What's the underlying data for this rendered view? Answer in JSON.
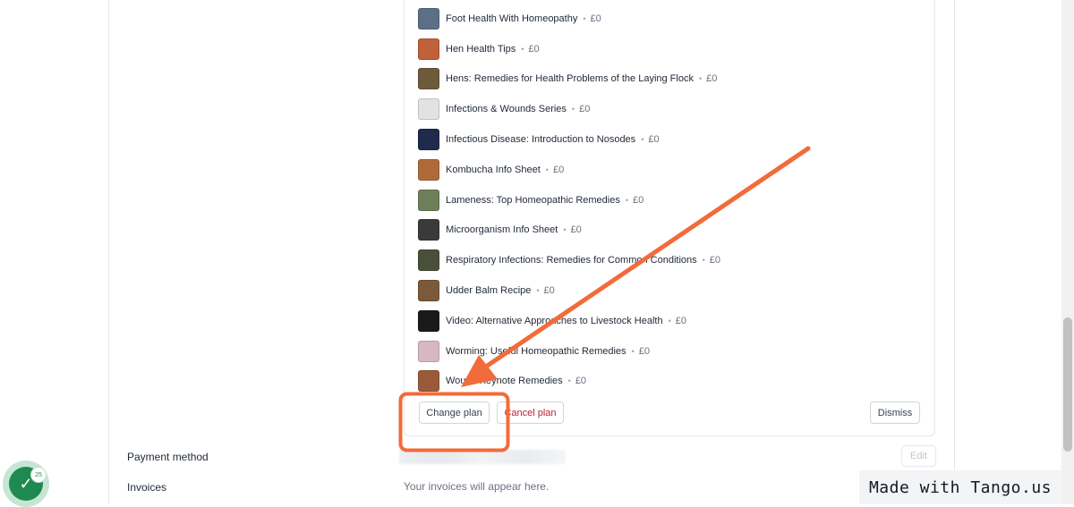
{
  "products": [
    {
      "name": "Foot Health With Homeopathy",
      "price": "£0",
      "thumb": "#5b6f86"
    },
    {
      "name": "Hen Health Tips",
      "price": "£0",
      "thumb": "#c0613a"
    },
    {
      "name": "Hens: Remedies for Health Problems of the Laying Flock",
      "price": "£0",
      "thumb": "#6d5a3a"
    },
    {
      "name": "Infections & Wounds Series",
      "price": "£0",
      "thumb": "#e2e2e2"
    },
    {
      "name": "Infectious Disease: Introduction to Nosodes",
      "price": "£0",
      "thumb": "#1f2a4d"
    },
    {
      "name": "Kombucha Info Sheet",
      "price": "£0",
      "thumb": "#b06a3a"
    },
    {
      "name": "Lameness: Top Homeopathic Remedies",
      "price": "£0",
      "thumb": "#6c7f59"
    },
    {
      "name": "Microorganism Info Sheet",
      "price": "£0",
      "thumb": "#3a3a3a"
    },
    {
      "name": "Respiratory Infections: Remedies for Common Conditions",
      "price": "£0",
      "thumb": "#4a4f3c"
    },
    {
      "name": "Udder Balm Recipe",
      "price": "£0",
      "thumb": "#7a5a3a"
    },
    {
      "name": "Video: Alternative Approaches to Livestock Health",
      "price": "£0",
      "thumb": "#1a1a1a"
    },
    {
      "name": "Worming: Useful Homeopathic Remedies",
      "price": "£0",
      "thumb": "#d8b8c0"
    },
    {
      "name": "Wound Keynote Remedies",
      "price": "£0",
      "thumb": "#9a5a3a"
    }
  ],
  "actions": {
    "change_plan": "Change plan",
    "cancel_plan": "Cancel plan",
    "dismiss": "Dismiss",
    "edit": "Edit"
  },
  "payment_method": {
    "label": "Payment method"
  },
  "invoices": {
    "label": "Invoices",
    "empty_text": "Your invoices will appear here."
  },
  "tango": {
    "count": "25",
    "watermark": "Made with Tango.us"
  },
  "colors": {
    "highlight": "#f26b3a",
    "accent_green": "#1e8a4f",
    "cancel_red": "#b4233a"
  }
}
